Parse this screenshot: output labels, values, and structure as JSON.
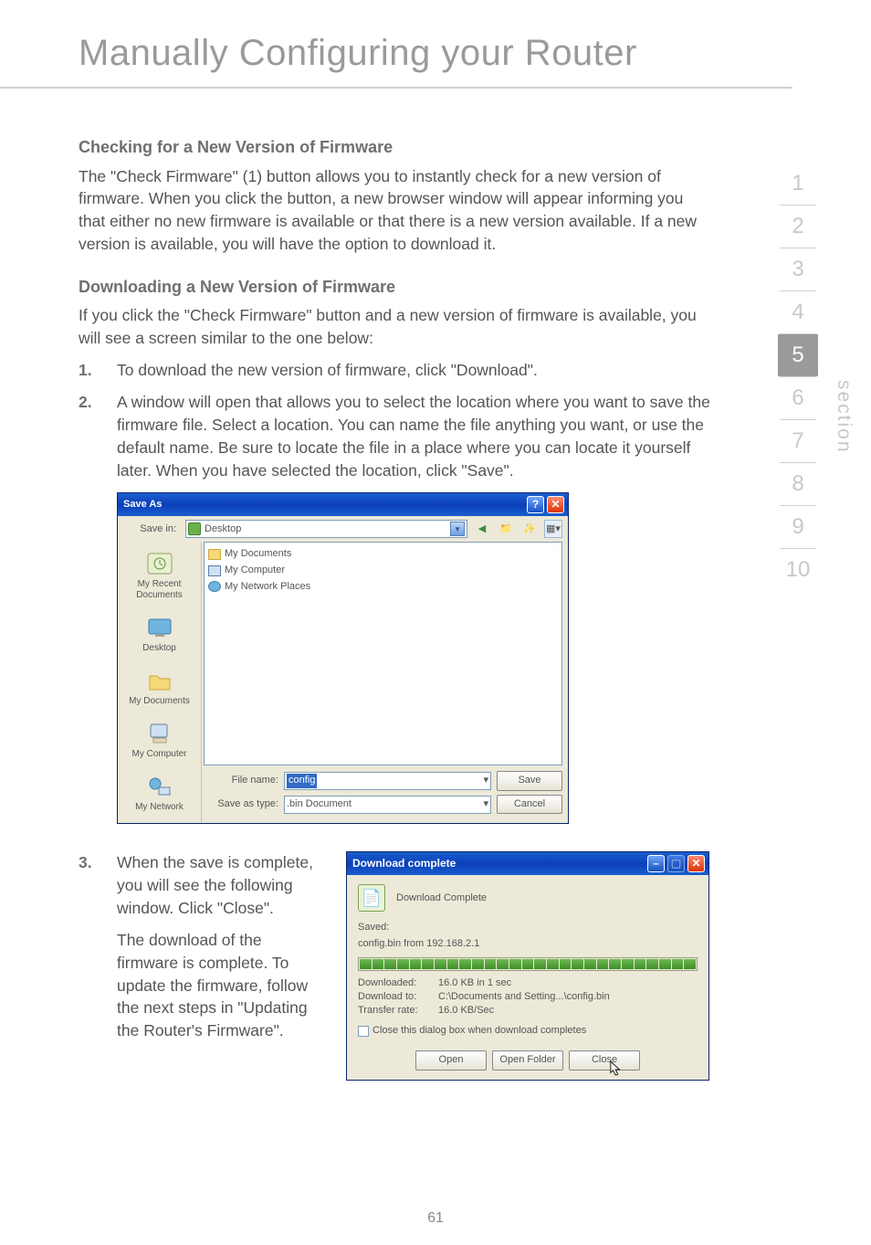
{
  "page": {
    "title": "Manually Configuring your Router",
    "number": "61"
  },
  "side_nav": {
    "label": "section",
    "items": [
      "1",
      "2",
      "3",
      "4",
      "5",
      "6",
      "7",
      "8",
      "9",
      "10"
    ],
    "active": "5"
  },
  "sections": {
    "check_heading": "Checking for a New Version of Firmware",
    "check_body": "The \"Check Firmware\" (1) button allows you to instantly check for a new version of firmware. When you click the button, a new browser window will appear informing you that either no new firmware is available or that there is a new version available. If a new version is available, you will have the option to download it.",
    "download_heading": "Downloading a New Version of Firmware",
    "download_intro": "If you click the \"Check Firmware\" button and a new version of firmware is available, you will see a screen similar to the one below:",
    "steps": {
      "one_num": "1.",
      "one_text": "To download the new version of firmware, click \"Download\".",
      "two_num": "2.",
      "two_text": "A window will open that allows you to select the location where you want to save the firmware file. Select a location. You can name the file anything you want, or use the default name. Be sure to locate the file in a place where you can locate it yourself later. When you have selected the location, click \"Save\".",
      "three_num": "3.",
      "three_text": "When the save is complete, you will see the following window. Click \"Close\".",
      "three_followup": "The download of the firmware is complete. To update the firmware, follow the next steps in \"Updating the Router's Firmware\"."
    }
  },
  "save_as": {
    "title": "Save As",
    "save_in_label": "Save in:",
    "save_in_value": "Desktop",
    "places": {
      "recent": "My Recent Documents",
      "desktop": "Desktop",
      "mydocs": "My Documents",
      "mycomp": "My Computer",
      "mynet": "My Network"
    },
    "files": {
      "mydocuments": "My Documents",
      "mycomputer": "My Computer",
      "mynetplaces": "My Network Places"
    },
    "filename_label": "File name:",
    "filename_value": "config",
    "type_label": "Save as type:",
    "type_value": ".bin Document",
    "save_btn": "Save",
    "cancel_btn": "Cancel"
  },
  "download_complete": {
    "title": "Download complete",
    "main_label": "Download Complete",
    "saved_label": "Saved:",
    "saved_from": "config.bin from 192.168.2.1",
    "downloaded_k": "Downloaded:",
    "downloaded_v": "16.0 KB in 1 sec",
    "downloadto_k": "Download to:",
    "downloadto_v": "C:\\Documents and Setting...\\config.bin",
    "rate_k": "Transfer rate:",
    "rate_v": "16.0 KB/Sec",
    "close_checkbox": "Close this dialog box when download completes",
    "open_btn": "Open",
    "openfolder_btn": "Open Folder",
    "close_btn": "Close"
  }
}
